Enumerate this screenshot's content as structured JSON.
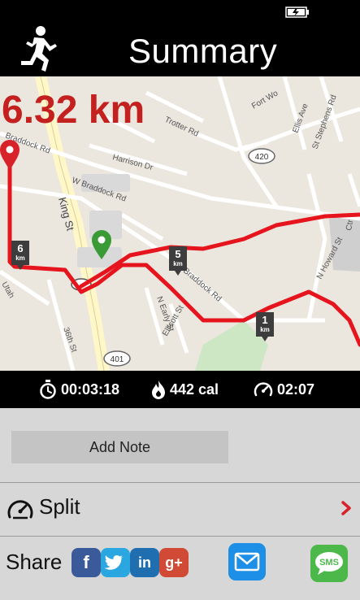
{
  "title": "Summary",
  "distance": "6.32 km",
  "map": {
    "street_labels": [
      "Braddock Rd",
      "Harrison Dr",
      "Trotter Rd",
      "W Braddock Rd",
      "King St",
      "Braddock Rd",
      "N Early St",
      "Ellicott St",
      "N Howard St",
      "St Stephens Rd",
      "Fort Wo",
      "Ellis Ave",
      "36th St",
      "Utah",
      "Ctr"
    ],
    "route_badges": [
      "420",
      "401"
    ],
    "km_markers": [
      {
        "num": "6",
        "unit": "km"
      },
      {
        "num": "5",
        "unit": "km"
      },
      {
        "num": "1",
        "unit": "km"
      }
    ]
  },
  "stats": {
    "time": "00:03:18",
    "calories": "442 cal",
    "pace": "02:07"
  },
  "actions": {
    "add_note": "Add Note",
    "split": "Split",
    "share": "Share",
    "sms": "SMS"
  },
  "colors": {
    "accent": "#c3201f",
    "route": "#e5141d",
    "facebook": "#3b5a9a",
    "twitter": "#2aa6e0",
    "linkedin": "#1f6fb0",
    "google": "#d04a36",
    "mail": "#1e8fe6",
    "sms": "#4cb84a"
  },
  "icons": [
    "battery-icon",
    "runner-icon",
    "start-pin-icon",
    "finish-pin-icon",
    "stopwatch-icon",
    "flame-icon",
    "pace-gauge-icon",
    "chevron-right-icon",
    "facebook-icon",
    "twitter-icon",
    "linkedin-icon",
    "google-plus-icon",
    "mail-icon",
    "sms-icon"
  ]
}
